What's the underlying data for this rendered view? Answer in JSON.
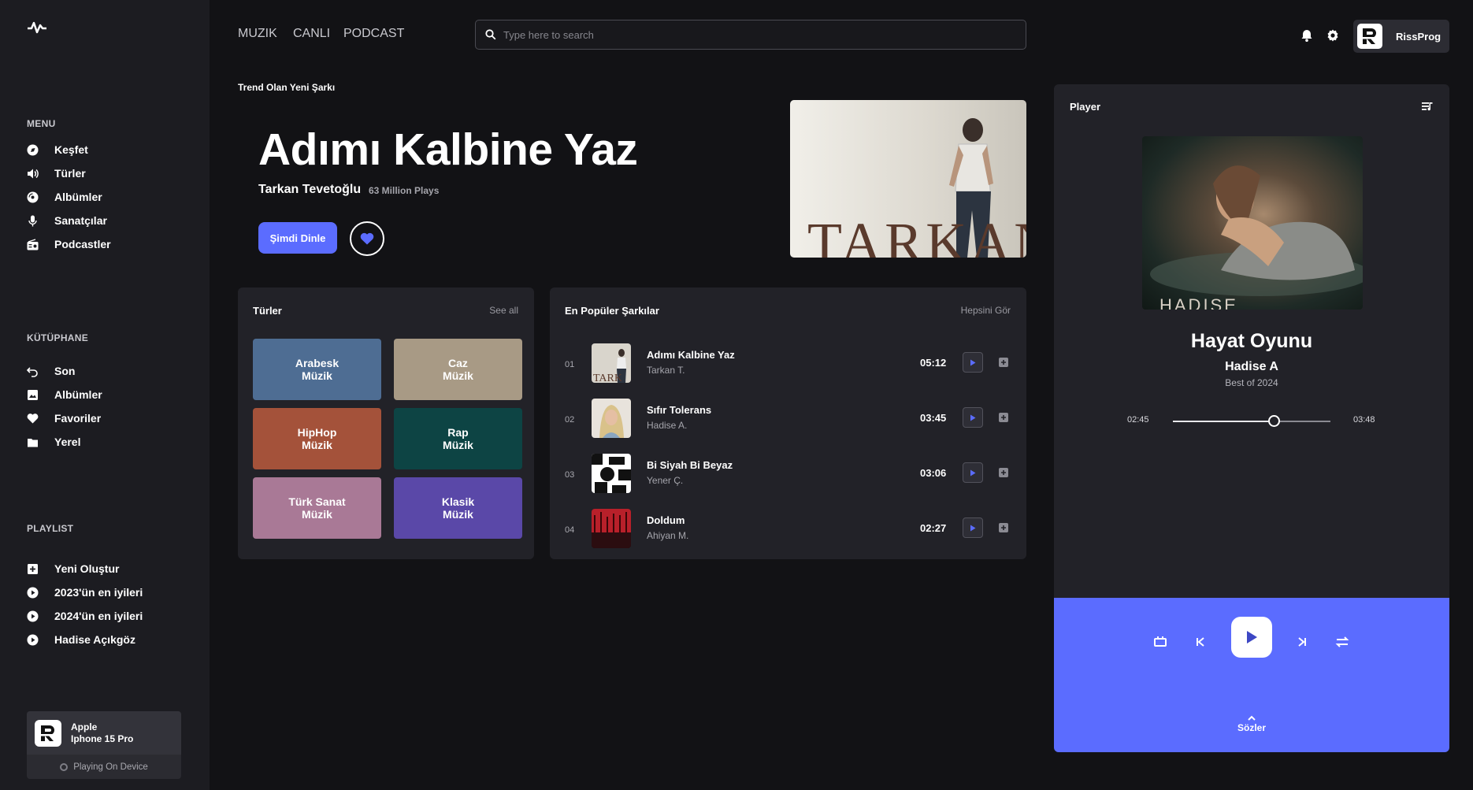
{
  "sidebar": {
    "menu_title": "MENU",
    "menu": [
      {
        "label": "Keşfet",
        "icon": "compass-icon"
      },
      {
        "label": "Türler",
        "icon": "speaker-icon"
      },
      {
        "label": "Albümler",
        "icon": "disc-icon"
      },
      {
        "label": "Sanatçılar",
        "icon": "microphone-icon"
      },
      {
        "label": "Podcastler",
        "icon": "radio-icon"
      }
    ],
    "library_title": "KÜTÜPHANE",
    "library": [
      {
        "label": "Son",
        "icon": "undo-icon"
      },
      {
        "label": "Albümler",
        "icon": "album-icon"
      },
      {
        "label": "Favoriler",
        "icon": "heart-icon"
      },
      {
        "label": "Yerel",
        "icon": "folder-icon"
      }
    ],
    "playlist_title": "PLAYLIST",
    "playlists": [
      {
        "label": "Yeni Oluştur",
        "icon": "plus-square-icon"
      },
      {
        "label": "2023'ün en iyileri",
        "icon": "play-circle-icon"
      },
      {
        "label": "2024'ün en iyileri",
        "icon": "play-circle-icon"
      },
      {
        "label": "Hadise Açıkgöz",
        "icon": "play-circle-icon"
      }
    ],
    "device": {
      "brand": "Apple",
      "model": "Iphone 15 Pro",
      "status": "Playing On Device"
    }
  },
  "topnav": {
    "items": [
      "MUZIK",
      "CANLI",
      "PODCAST"
    ]
  },
  "search": {
    "placeholder": "Type here to search"
  },
  "profile": {
    "name": "RissProg"
  },
  "hero": {
    "label": "Trend Olan Yeni Şarkı",
    "title": "Adımı Kalbine Yaz",
    "artist": "Tarkan Tevetoğlu",
    "plays": "63 Million Plays",
    "listen_label": "Şimdi Dinle",
    "image_text": "TARKAN"
  },
  "genres": {
    "title": "Türler",
    "see_all": "See all",
    "items": [
      {
        "line1": "Arabesk",
        "line2": "Müzik",
        "color": "#4e6d93"
      },
      {
        "line1": "Caz",
        "line2": "Müzik",
        "color": "#a89a85"
      },
      {
        "line1": "HipHop",
        "line2": "Müzik",
        "color": "#a4523a"
      },
      {
        "line1": "Rap",
        "line2": "Müzik",
        "color": "#0d4444"
      },
      {
        "line1": "Türk Sanat",
        "line2": "Müzik",
        "color": "#a97996"
      },
      {
        "line1": "Klasik",
        "line2": "Müzik",
        "color": "#5a48a8"
      }
    ]
  },
  "popular": {
    "title": "En Popüler Şarkılar",
    "see_all": "Hepsini Gör",
    "songs": [
      {
        "num": "01",
        "title": "Adımı Kalbine Yaz",
        "artist": "Tarkan T.",
        "duration": "05:12"
      },
      {
        "num": "02",
        "title": "Sıfır Tolerans",
        "artist": "Hadise A.",
        "duration": "03:45"
      },
      {
        "num": "03",
        "title": "Bi Siyah Bi Beyaz",
        "artist": "Yener Ç.",
        "duration": "03:06"
      },
      {
        "num": "04",
        "title": "Doldum",
        "artist": "Ahiyan M.",
        "duration": "02:27"
      }
    ]
  },
  "player": {
    "title": "Player",
    "song": "Hayat Oyunu",
    "artist": "Hadise A",
    "album": "Best of 2024",
    "art_text": "HADISE",
    "current_time": "02:45",
    "total_time": "03:48",
    "progress": 0.64,
    "lyrics_label": "Sözler"
  },
  "colors": {
    "accent": "#5b6cff",
    "sidebar": "#1c1c21",
    "panel": "#222228",
    "background": "#121215"
  }
}
